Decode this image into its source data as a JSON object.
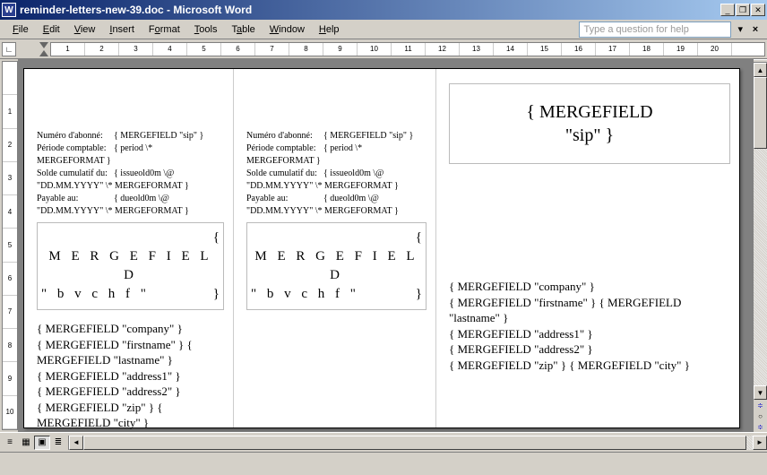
{
  "titlebar": {
    "title": "reminder-letters-new-39.doc - Microsoft Word"
  },
  "menu": {
    "file": "File",
    "edit": "Edit",
    "view": "View",
    "insert": "Insert",
    "format": "Format",
    "tools": "Tools",
    "table": "Table",
    "window": "Window",
    "help": "Help",
    "helpbox_placeholder": "Type a question for help"
  },
  "ruler": {
    "hmarks": [
      "1",
      "2",
      "3",
      "4",
      "5",
      "6",
      "7",
      "8",
      "9",
      "10",
      "11",
      "12",
      "13",
      "14",
      "15",
      "16",
      "17",
      "18",
      "19",
      "20"
    ],
    "vmarks": [
      "",
      "1",
      "2",
      "3",
      "4",
      "5",
      "6",
      "7",
      "8",
      "9",
      "10"
    ]
  },
  "doc": {
    "col1": {
      "l_sub": "Numéro d'abonné:",
      "v_sub": "{ MERGEFIELD \"sip\" }",
      "l_period": "Période comptable:",
      "v_period": "{ period \\*",
      "mfmt1": "MERGEFORMAT }",
      "l_solde": "Solde cumulatif du:",
      "v_solde": "{ issueold0m \\@",
      "solde2": "\"DD.MM.YYYY\" \\* MERGEFORMAT }",
      "l_pay": "Payable au:",
      "v_pay": "{ dueold0m \\@",
      "pay2": "\"DD.MM.YYYY\" \\* MERGEFORMAT }",
      "mfbox_brace_open": "{",
      "mfbox_line1": "M E R G E F I E L D",
      "mfbox_line2": "\" b v c h f \"",
      "mfbox_brace_close": "}",
      "body1": "{ MERGEFIELD \"company\" }",
      "body2": "{ MERGEFIELD \"firstname\" } {",
      "body3": "MERGEFIELD \"lastname\" }",
      "body4": "{ MERGEFIELD \"address1\" }",
      "body5": "{ MERGEFIELD \"address2\" }",
      "body6": "{ MERGEFIELD \"zip\" } {",
      "body7": "MERGEFIELD \"city\" }"
    },
    "col2": {
      "l_sub": "Numéro d'abonné:",
      "v_sub": "{ MERGEFIELD \"sip\" }",
      "l_period": "Période comptable:",
      "v_period": "{ period \\*",
      "mfmt1": "MERGEFORMAT }",
      "l_solde": "Solde cumulatif du:",
      "v_solde": "{ issueold0m \\@",
      "solde2": "\"DD.MM.YYYY\" \\* MERGEFORMAT }",
      "l_pay": "Payable au:",
      "v_pay": "{ dueold0m \\@",
      "pay2": "\"DD.MM.YYYY\" \\* MERGEFORMAT }",
      "mfbox_brace_open": "{",
      "mfbox_line1": "M E R G E F I E L D",
      "mfbox_line2": "\" b v c h f \"",
      "mfbox_brace_close": "}"
    },
    "col3": {
      "big1": "{ MERGEFIELD",
      "big2": "\"sip\" }",
      "body1": "{ MERGEFIELD \"company\" }",
      "body2": "{ MERGEFIELD \"firstname\" } { MERGEFIELD",
      "body3": "\"lastname\" }",
      "body4": "{ MERGEFIELD \"address1\" }",
      "body5": "{ MERGEFIELD \"address2\" }",
      "body6": "{ MERGEFIELD \"zip\" } { MERGEFIELD \"city\" }"
    }
  }
}
